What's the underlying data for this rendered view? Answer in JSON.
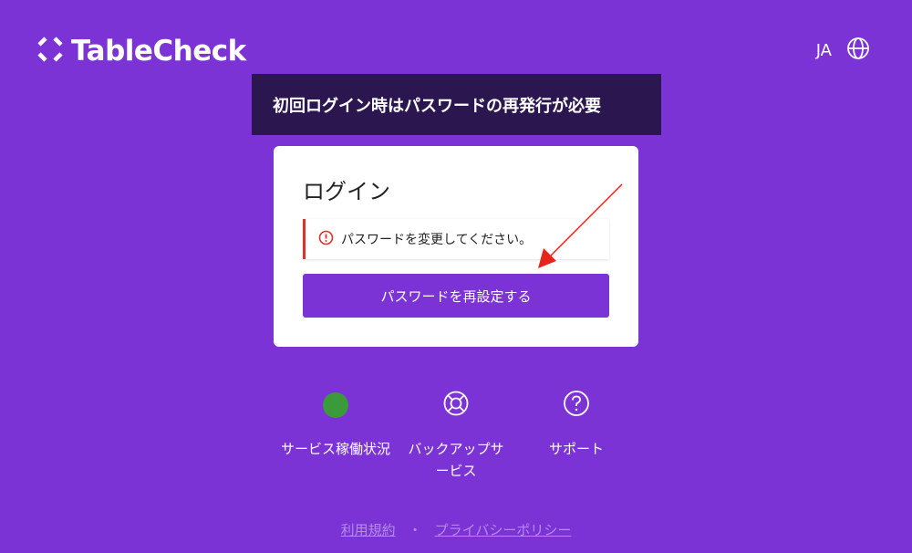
{
  "header": {
    "logo_text": "TableCheck",
    "language_code": "JA",
    "language_icon": "globe-icon"
  },
  "banner": {
    "text": "初回ログイン時はパスワードの再発行が必要"
  },
  "login_card": {
    "title": "ログイン",
    "alert_icon": "error-circle-icon",
    "alert_text": "パスワードを変更してください。",
    "reset_button_label": "パスワードを再設定する"
  },
  "footer": {
    "items": [
      {
        "icon": "status-dot-icon",
        "label": "サービス稼働状況"
      },
      {
        "icon": "lifebuoy-icon",
        "label": "バックアップサービス"
      },
      {
        "icon": "question-circle-icon",
        "label": "サポート"
      }
    ],
    "links": {
      "terms": "利用規約",
      "separator": "・",
      "privacy": "プライバシーポリシー"
    }
  },
  "colors": {
    "background": "#7B33D6",
    "banner": "#2B1650",
    "alert_accent": "#D9342B",
    "status_ok": "#3B9B3A",
    "annotation_arrow": "#E8231A"
  }
}
